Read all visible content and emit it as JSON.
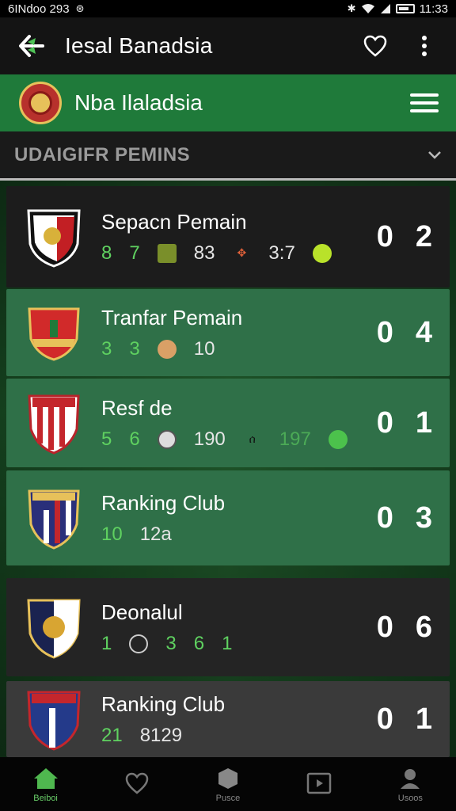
{
  "status_bar": {
    "left_text": "6INdoo 293",
    "time": "11:33"
  },
  "app_bar": {
    "title": "Iesal Banadsia"
  },
  "green_bar": {
    "title": "Nba Ilaladsia"
  },
  "section": {
    "title": "UDAIGIFR PEMINS"
  },
  "cards": [
    {
      "title": "Sepacn Pemain",
      "stats": [
        "8",
        "7",
        "83",
        "3:7"
      ],
      "score": [
        "0",
        "2"
      ]
    },
    {
      "title": "Tranfar Pemain",
      "stats": [
        "3",
        "3",
        "10"
      ],
      "score": [
        "0",
        "4"
      ]
    },
    {
      "title": "Resf de",
      "stats": [
        "5",
        "6",
        "190",
        "197"
      ],
      "score": [
        "0",
        "1"
      ]
    },
    {
      "title": "Ranking Club",
      "stats": [
        "10",
        "12a"
      ],
      "score": [
        "0",
        "3"
      ]
    },
    {
      "title": "Deonalul",
      "stats": [
        "1",
        "3",
        "6",
        "1"
      ],
      "score": [
        "0",
        "6"
      ]
    },
    {
      "title": "Ranking Club",
      "stats": [
        "21",
        "8129"
      ],
      "score": [
        "0",
        "1"
      ]
    }
  ],
  "bottom_nav": [
    {
      "label": "Beiboi",
      "icon": "home-icon"
    },
    {
      "label": "",
      "icon": "heart-icon"
    },
    {
      "label": "Pusce",
      "icon": "ball-icon"
    },
    {
      "label": "",
      "icon": "video-icon"
    },
    {
      "label": "Usoos",
      "icon": "user-icon"
    }
  ],
  "colors": {
    "primary_green": "#1f7a3a",
    "card_green": "#2f7048",
    "stat_green": "#5fd160"
  }
}
